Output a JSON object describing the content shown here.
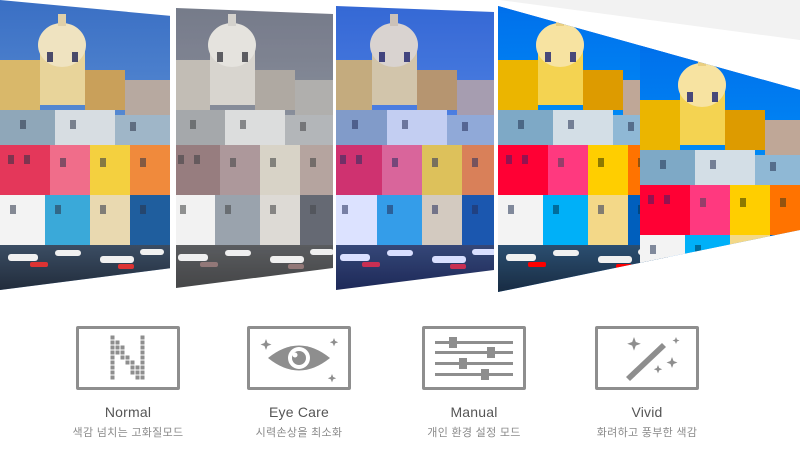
{
  "panels": [
    {
      "id": "normal",
      "tint": "none"
    },
    {
      "id": "eye-care",
      "tint": "gray"
    },
    {
      "id": "manual",
      "tint": "blue"
    },
    {
      "id": "vivid",
      "tint": "vivid"
    }
  ],
  "modes": [
    {
      "id": "normal",
      "name": "Normal",
      "desc": "색감 넘치는 고화질모드",
      "icon": "letter-n-icon"
    },
    {
      "id": "eye-care",
      "name": "Eye Care",
      "desc": "시력손상을 최소화",
      "icon": "eye-icon"
    },
    {
      "id": "manual",
      "name": "Manual",
      "desc": "개인 환경 설정 모드",
      "icon": "sliders-icon"
    },
    {
      "id": "vivid",
      "name": "Vivid",
      "desc": "화려하고 풍부한 색감",
      "icon": "magic-wand-icon"
    }
  ],
  "colors": {
    "icon_gray": "#8e8e8e",
    "label_gray": "#555555",
    "desc_gray": "#8a8a8a"
  }
}
